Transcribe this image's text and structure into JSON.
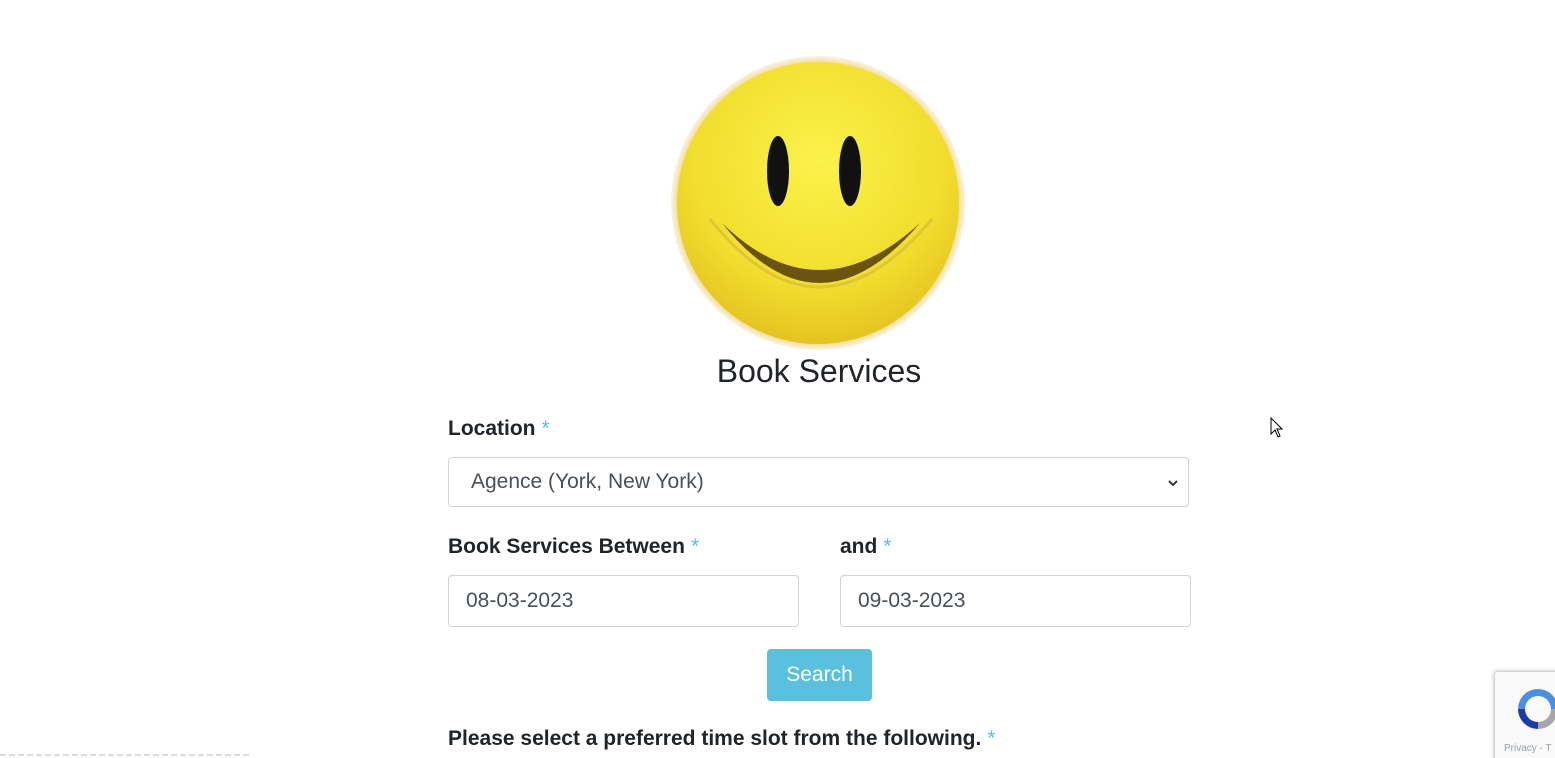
{
  "header": {
    "logo_icon": "smiley-face-logo",
    "title": "Book Services"
  },
  "form": {
    "location": {
      "label": "Location",
      "required_mark": "*",
      "selected_value": "Agence (York, New York)"
    },
    "start_date": {
      "label": "Book Services Between",
      "required_mark": "*",
      "value": "08-03-2023"
    },
    "end_date": {
      "label": "and",
      "required_mark": "*",
      "value": "09-03-2023"
    },
    "search_label": "Search",
    "time_slot": {
      "label": "Please select a preferred time slot from the following.",
      "required_mark": "*"
    }
  },
  "recaptcha": {
    "icon": "recaptcha-icon",
    "text": "Privacy - T"
  },
  "colors": {
    "accent": "#5bc0de",
    "required": "#5bc0de",
    "border": "#ced4da",
    "text": "#212529"
  }
}
